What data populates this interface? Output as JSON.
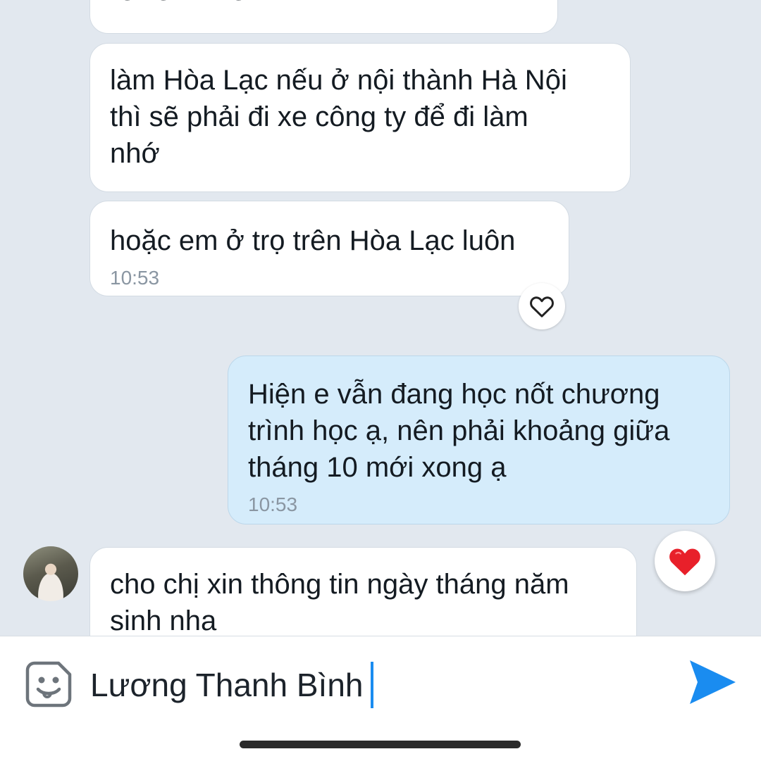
{
  "messages": [
    {
      "text": "review nhe",
      "time": ""
    },
    {
      "text": "làm Hòa Lạc nếu ở nội thành Hà Nội\nthì sẽ phải đi xe công ty để đi làm\nnhớ",
      "time": ""
    },
    {
      "text": "hoặc em ở trọ trên Hòa Lạc luôn",
      "time": "10:53"
    },
    {
      "text": "Hiện e vẫn đang học nốt chương\ntrình học ạ, nên phải khoảng giữa\ntháng 10 mới xong ạ",
      "time": "10:53"
    },
    {
      "text": "cho chị xin thông tin ngày tháng năm\nsinh nha",
      "time": ""
    }
  ],
  "reactions": {
    "empty": {
      "icon": "heart-outline-icon"
    },
    "filled": {
      "icon": "heart-filled-icon",
      "color": "#e8202a"
    }
  },
  "composer": {
    "value": "Lương Thanh Bình",
    "emoji_icon": "sticker-emoji-icon",
    "send_icon": "send-icon",
    "send_color": "#1a8cf0"
  }
}
